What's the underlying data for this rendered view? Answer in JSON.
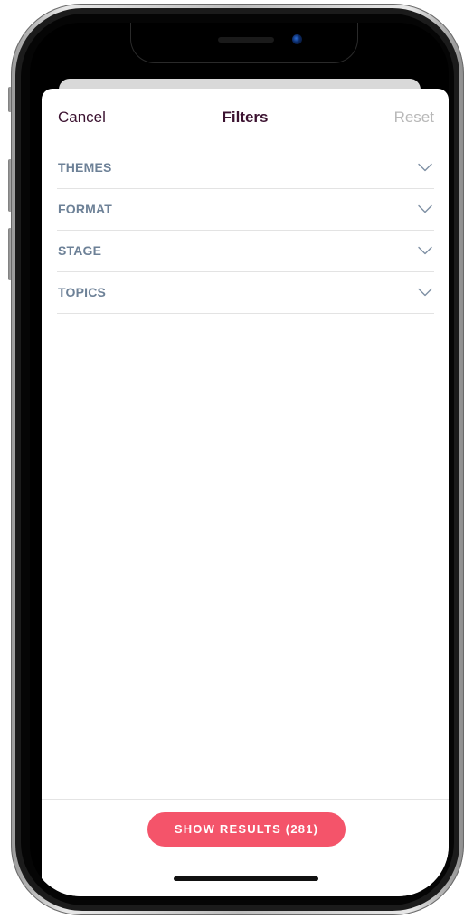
{
  "header": {
    "cancel_label": "Cancel",
    "title": "Filters",
    "reset_label": "Reset"
  },
  "filters": [
    {
      "label": "THEMES",
      "icon": "chevron-down-icon"
    },
    {
      "label": "FORMAT",
      "icon": "chevron-down-icon"
    },
    {
      "label": "STAGE",
      "icon": "chevron-down-icon"
    },
    {
      "label": "TOPICS",
      "icon": "chevron-down-icon"
    }
  ],
  "footer": {
    "show_results_label": "SHOW RESULTS (281)"
  },
  "colors": {
    "accent": "#f4546a",
    "title_text": "#3b1230",
    "filter_label": "#6d8197",
    "reset_disabled": "#b8b8b8"
  }
}
